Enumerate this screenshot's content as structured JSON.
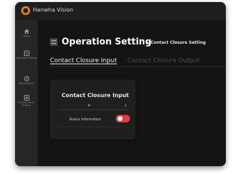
{
  "brand": {
    "name": "Hanwha Vision",
    "logo_color": "#e27a1e"
  },
  "sidebar": {
    "items": [
      {
        "label": "Home",
        "icon": "home-icon"
      },
      {
        "label": "Operation Setting",
        "icon": "operation-setting-icon"
      },
      {
        "label": "Maintenance",
        "icon": "maintenance-icon"
      },
      {
        "label": "Environment Setting",
        "icon": "environment-setting-icon"
      }
    ]
  },
  "header": {
    "title": "Operation Setting",
    "breadcrumb": "> Contact Closure Setting"
  },
  "tabs": [
    {
      "label": "Contact Closure Input",
      "active": true
    },
    {
      "label": "Contact Closure Output",
      "active": false
    }
  ],
  "card": {
    "title": "Contact Closure Input",
    "columns": [
      "#",
      "1"
    ],
    "rows": [
      {
        "label": "Status information",
        "toggle_on": true
      }
    ]
  },
  "colors": {
    "toggle_on": "#e33d44",
    "background": "#141414",
    "sidebar": "#262626"
  }
}
